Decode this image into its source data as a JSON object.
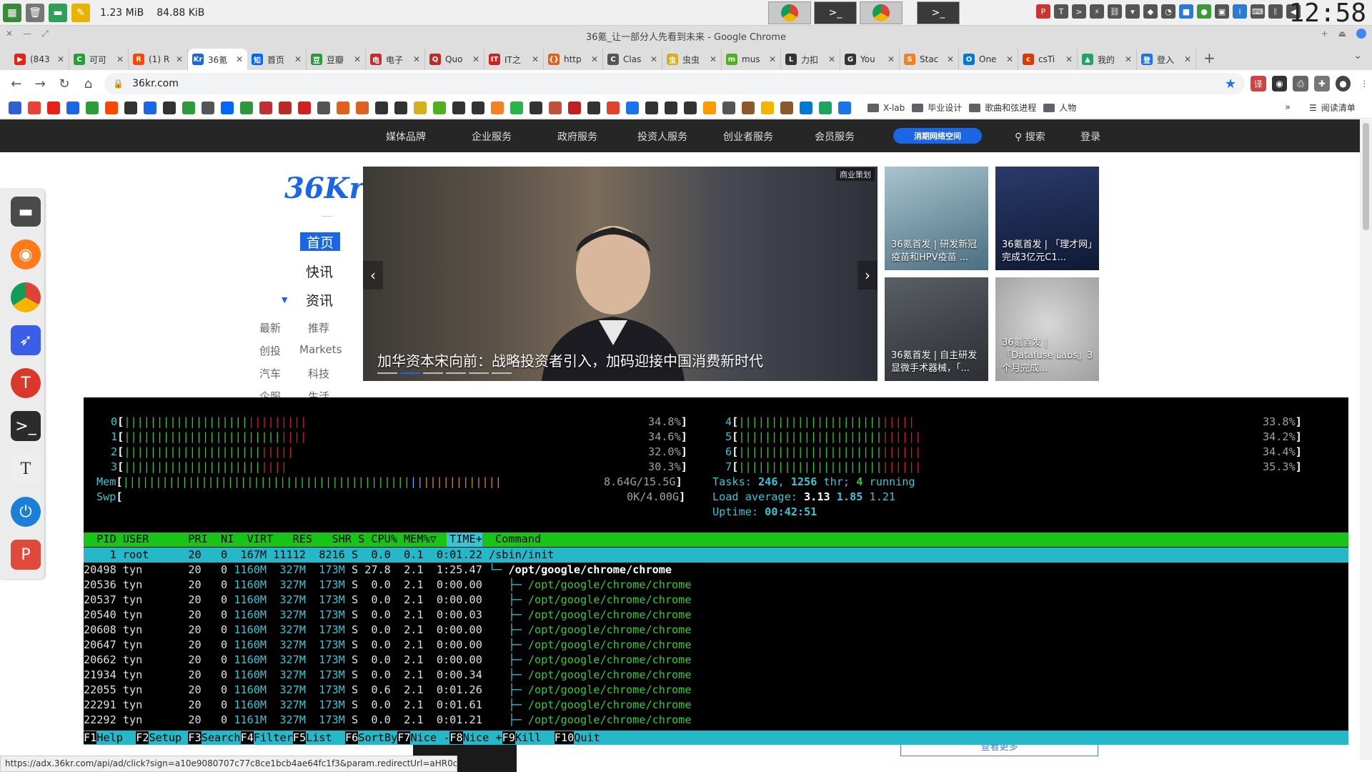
{
  "system_panel": {
    "mem_usage": "1.23 MiB",
    "net_rate": "84.88 KiB",
    "clock": "12:58"
  },
  "window": {
    "title": "36氪_让一部分人先看到未来 - Google Chrome"
  },
  "tabs": [
    {
      "label": "(843",
      "color": "#e62117",
      "glyph": "▶"
    },
    {
      "label": "可可",
      "color": "#2a9d3a",
      "glyph": "C"
    },
    {
      "label": "(1) R",
      "color": "#ff4500",
      "glyph": "R"
    },
    {
      "label": "36氪",
      "color": "#1b66e6",
      "glyph": "Kr",
      "active": true
    },
    {
      "label": "首页",
      "color": "#0066ff",
      "glyph": "知"
    },
    {
      "label": "豆瓣",
      "color": "#2e963d",
      "glyph": "豆"
    },
    {
      "label": "电子",
      "color": "#c03030",
      "glyph": "电"
    },
    {
      "label": "Quo",
      "color": "#b92b27",
      "glyph": "Q"
    },
    {
      "label": "IT之",
      "color": "#d02020",
      "glyph": "IT"
    },
    {
      "label": "http",
      "color": "#e06020",
      "glyph": "{}"
    },
    {
      "label": "Clas",
      "color": "#555555",
      "glyph": "C"
    },
    {
      "label": "虫虫",
      "color": "#d4b020",
      "glyph": "虫"
    },
    {
      "label": "mus",
      "color": "#50b020",
      "glyph": "m"
    },
    {
      "label": "力扣",
      "color": "#333333",
      "glyph": "L"
    },
    {
      "label": "You",
      "color": "#333333",
      "glyph": "G"
    },
    {
      "label": "Stac",
      "color": "#f48024",
      "glyph": "S"
    },
    {
      "label": "One",
      "color": "#0078d4",
      "glyph": "O"
    },
    {
      "label": "csTi",
      "color": "#d83b01",
      "glyph": "c"
    },
    {
      "label": "我的",
      "color": "#1fa463",
      "glyph": "▲"
    },
    {
      "label": "登入",
      "color": "#1a73e8",
      "glyph": "登"
    }
  ],
  "omnibox": {
    "url": "36kr.com"
  },
  "bookmarks": {
    "folders": [
      "X-lab",
      "毕业设计",
      "歌曲和弦进程",
      "人物"
    ],
    "more": "»",
    "reading_list": "阅读清单"
  },
  "kr_nav": {
    "items": [
      "媒体品牌",
      "企业服务",
      "政府服务",
      "投资人服务",
      "创业者服务",
      "会员服务"
    ],
    "pill": "消期网络空间",
    "search": "搜索",
    "login": "登录"
  },
  "kr_side": {
    "logo": "36Kr",
    "home": "首页",
    "flash": "快讯",
    "news": "资讯",
    "sub": [
      [
        "最新",
        "推荐"
      ],
      [
        "创投",
        "Markets"
      ],
      [
        "汽车",
        "科技"
      ],
      [
        "企服",
        "生活"
      ]
    ]
  },
  "banner": {
    "caption": "加华资本宋向前：战略投资者引入，加码迎接中国消费新时代",
    "tag": "商业策划"
  },
  "thumbs": [
    {
      "caption": "36氪首发 | 研发新冠疫苗和HPV疫苗 ..."
    },
    {
      "caption": "36氪首发 | 「理才网」完成3亿元C1..."
    },
    {
      "caption": "36氪首发 | 自主研发显微手术器械，「..."
    },
    {
      "caption": "36氪首发 | 「Datafuse Labs」3个月完成..."
    }
  ],
  "ad": {
    "more": "查看更多"
  },
  "htop": {
    "cpus": [
      {
        "id": "0",
        "pct": "34.8%",
        "green": 19,
        "red": 9
      },
      {
        "id": "1",
        "pct": "34.6%",
        "green": 24,
        "red": 4
      },
      {
        "id": "2",
        "pct": "32.0%",
        "green": 21,
        "red": 5
      },
      {
        "id": "3",
        "pct": "30.3%",
        "green": 21,
        "red": 4
      },
      {
        "id": "4",
        "pct": "33.8%",
        "green": 22,
        "red": 5
      },
      {
        "id": "5",
        "pct": "34.2%",
        "green": 22,
        "red": 6
      },
      {
        "id": "6",
        "pct": "34.4%",
        "green": 22,
        "red": 6
      },
      {
        "id": "7",
        "pct": "35.3%",
        "green": 22,
        "red": 6
      }
    ],
    "mem": {
      "label": "Mem",
      "value": "8.64G/15.5G",
      "green": 44,
      "blue": 2,
      "orange": 12
    },
    "swp": {
      "label": "Swp",
      "value": "0K/4.00G"
    },
    "tasks": {
      "label": "Tasks:",
      "tasks": "246",
      "thr": "1256",
      "thr_label": "thr;",
      "running": "4",
      "running_label": "running"
    },
    "load": {
      "label": "Load average:",
      "l1": "3.13",
      "l5": "1.85",
      "l15": "1.21"
    },
    "uptime": {
      "label": "Uptime:",
      "value": "00:42:51"
    },
    "header": "  PID USER      PRI  NI  VIRT   RES   SHR S CPU% MEM%▽  TIME+  Command",
    "rows": [
      {
        "pid": "1",
        "user": "root",
        "pri": "20",
        "ni": "0",
        "virt": "167M",
        "res": "11112",
        "shr": "8216",
        "s": "S",
        "cpu": "0.0",
        "mem": "0.1",
        "time": "0:01.22",
        "cmd": "/sbin/init",
        "selected": true
      },
      {
        "pid": "20498",
        "user": "tyn",
        "pri": "20",
        "ni": "0",
        "virt": "1160M",
        "res": "327M",
        "shr": "173M",
        "s": "S",
        "cpu": "27.8",
        "mem": "2.1",
        "time": "1:25.47",
        "cmd": "/opt/google/chrome/chrome",
        "tree": "└─ "
      },
      {
        "pid": "20536",
        "user": "tyn",
        "pri": "20",
        "ni": "0",
        "virt": "1160M",
        "res": "327M",
        "shr": "173M",
        "s": "S",
        "cpu": "0.0",
        "mem": "2.1",
        "time": "0:00.00",
        "cmd": "/opt/google/chrome/chrome",
        "tree": "   ├─ "
      },
      {
        "pid": "20537",
        "user": "tyn",
        "pri": "20",
        "ni": "0",
        "virt": "1160M",
        "res": "327M",
        "shr": "173M",
        "s": "S",
        "cpu": "0.0",
        "mem": "2.1",
        "time": "0:00.00",
        "cmd": "/opt/google/chrome/chrome",
        "tree": "   ├─ "
      },
      {
        "pid": "20540",
        "user": "tyn",
        "pri": "20",
        "ni": "0",
        "virt": "1160M",
        "res": "327M",
        "shr": "173M",
        "s": "S",
        "cpu": "0.0",
        "mem": "2.1",
        "time": "0:00.03",
        "cmd": "/opt/google/chrome/chrome",
        "tree": "   ├─ "
      },
      {
        "pid": "20608",
        "user": "tyn",
        "pri": "20",
        "ni": "0",
        "virt": "1160M",
        "res": "327M",
        "shr": "173M",
        "s": "S",
        "cpu": "0.0",
        "mem": "2.1",
        "time": "0:00.00",
        "cmd": "/opt/google/chrome/chrome",
        "tree": "   ├─ "
      },
      {
        "pid": "20647",
        "user": "tyn",
        "pri": "20",
        "ni": "0",
        "virt": "1160M",
        "res": "327M",
        "shr": "173M",
        "s": "S",
        "cpu": "0.0",
        "mem": "2.1",
        "time": "0:00.00",
        "cmd": "/opt/google/chrome/chrome",
        "tree": "   ├─ "
      },
      {
        "pid": "20662",
        "user": "tyn",
        "pri": "20",
        "ni": "0",
        "virt": "1160M",
        "res": "327M",
        "shr": "173M",
        "s": "S",
        "cpu": "0.0",
        "mem": "2.1",
        "time": "0:00.00",
        "cmd": "/opt/google/chrome/chrome",
        "tree": "   ├─ "
      },
      {
        "pid": "21934",
        "user": "tyn",
        "pri": "20",
        "ni": "0",
        "virt": "1160M",
        "res": "327M",
        "shr": "173M",
        "s": "S",
        "cpu": "0.0",
        "mem": "2.1",
        "time": "0:00.34",
        "cmd": "/opt/google/chrome/chrome",
        "tree": "   ├─ "
      },
      {
        "pid": "22055",
        "user": "tyn",
        "pri": "20",
        "ni": "0",
        "virt": "1160M",
        "res": "327M",
        "shr": "173M",
        "s": "S",
        "cpu": "0.6",
        "mem": "2.1",
        "time": "0:01.26",
        "cmd": "/opt/google/chrome/chrome",
        "tree": "   ├─ "
      },
      {
        "pid": "22291",
        "user": "tyn",
        "pri": "20",
        "ni": "0",
        "virt": "1160M",
        "res": "327M",
        "shr": "173M",
        "s": "S",
        "cpu": "0.0",
        "mem": "2.1",
        "time": "0:01.61",
        "cmd": "/opt/google/chrome/chrome",
        "tree": "   ├─ "
      },
      {
        "pid": "22292",
        "user": "tyn",
        "pri": "20",
        "ni": "0",
        "virt": "1161M",
        "res": "327M",
        "shr": "173M",
        "s": "S",
        "cpu": "0.0",
        "mem": "2.1",
        "time": "0:01.21",
        "cmd": "/opt/google/chrome/chrome",
        "tree": "   ├─ "
      }
    ],
    "fkeys": [
      {
        "key": "F1",
        "label": "Help  "
      },
      {
        "key": "F2",
        "label": "Setup "
      },
      {
        "key": "F3",
        "label": "Search"
      },
      {
        "key": "F4",
        "label": "Filter"
      },
      {
        "key": "F5",
        "label": "List  "
      },
      {
        "key": "F6",
        "label": "SortBy"
      },
      {
        "key": "F7",
        "label": "Nice -"
      },
      {
        "key": "F8",
        "label": "Nice +"
      },
      {
        "key": "F9",
        "label": "Kill  "
      },
      {
        "key": "F10",
        "label": "Quit"
      }
    ]
  },
  "status_url": "https://adx.36kr.com/api/ad/click?sign=a10e9080707c77c8ce1bcb4ae64fc1f3&param.redirectUrl=aHR0c...",
  "colors": {
    "accent": "#1b66e6",
    "htop_cyan": "#24b8c8",
    "htop_green": "#17c417",
    "kr_nav_bg": "#262626"
  }
}
